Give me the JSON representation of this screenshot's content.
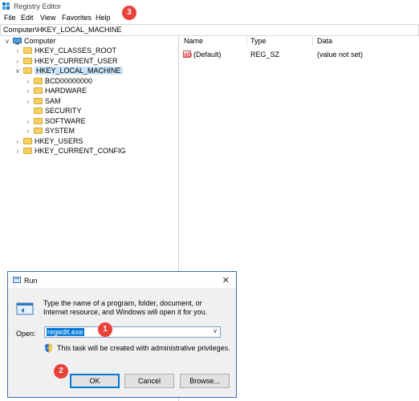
{
  "window": {
    "title": "Registry Editor"
  },
  "menu": [
    "File",
    "Edit",
    "View",
    "Favorites",
    "Help"
  ],
  "address": "Computer\\HKEY_LOCAL_MACHINE",
  "tree": {
    "root": "Computer",
    "hives": [
      "HKEY_CLASSES_ROOT",
      "HKEY_CURRENT_USER",
      "HKEY_LOCAL_MACHINE",
      "HKEY_USERS",
      "HKEY_CURRENT_CONFIG"
    ],
    "hklm_children": [
      "BCD00000000",
      "HARDWARE",
      "SAM",
      "SECURITY",
      "SOFTWARE",
      "SYSTEM"
    ],
    "selected": "HKEY_LOCAL_MACHINE"
  },
  "list": {
    "columns": [
      "Name",
      "Type",
      "Data"
    ],
    "rows": [
      {
        "name": "(Default)",
        "type": "REG_SZ",
        "data": "(value not set)"
      }
    ]
  },
  "callouts": [
    "1",
    "2",
    "3"
  ],
  "run_dialog": {
    "title": "Run",
    "close_glyph": "✕",
    "description": "Type the name of a program, folder, document, or Internet resource, and Windows will open it for you.",
    "open_label": "Open:",
    "open_value": "regedit.exe",
    "admin_note": "This task will be created with administrative privileges.",
    "buttons": {
      "ok": "OK",
      "cancel": "Cancel",
      "browse": "Browse..."
    }
  },
  "colors": {
    "callout": "#e8413a",
    "selection": "#cce4f7",
    "folder": "#f5d167",
    "accent": "#0078d7"
  }
}
